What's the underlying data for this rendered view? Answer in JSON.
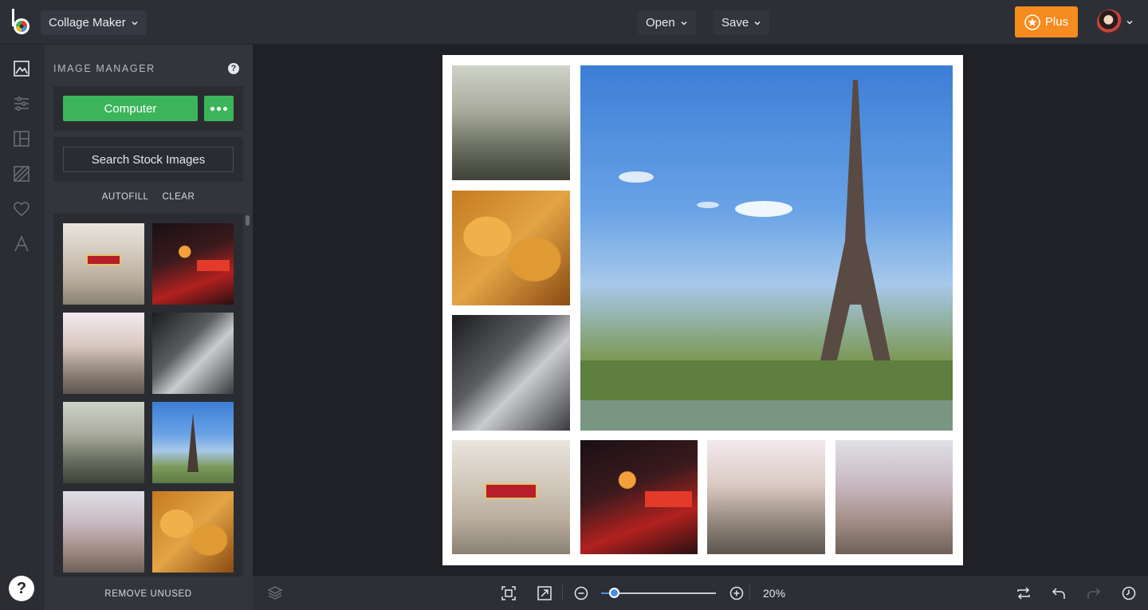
{
  "header": {
    "app_menu_label": "Collage Maker",
    "open_label": "Open",
    "save_label": "Save",
    "plus_label": "Plus"
  },
  "colors": {
    "accent_orange": "#f48c1f",
    "accent_green": "#3cb55a",
    "zoom_blue": "#4a8fe0"
  },
  "rail": {
    "icons": [
      "image-icon",
      "sliders-icon",
      "layout-icon",
      "background-icon",
      "heart-icon",
      "text-icon"
    ],
    "help_label": "?"
  },
  "panel": {
    "title": "IMAGE MANAGER",
    "help_label": "?",
    "computer_label": "Computer",
    "stock_label": "Search Stock Images",
    "autofill_label": "AUTOFILL",
    "clear_label": "CLEAR",
    "remove_unused_label": "REMOVE UNUSED"
  },
  "thumbnails": [
    {
      "name": "metro"
    },
    {
      "name": "moulin-rouge"
    },
    {
      "name": "street"
    },
    {
      "name": "louvre"
    },
    {
      "name": "balcony"
    },
    {
      "name": "eiffel"
    },
    {
      "name": "montmartre"
    },
    {
      "name": "croissants"
    }
  ],
  "bottombar": {
    "zoom_label": "20%",
    "zoom_level_percent": 11
  }
}
